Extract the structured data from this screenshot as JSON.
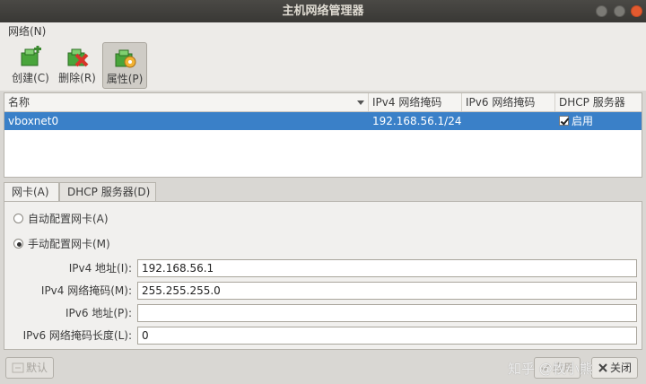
{
  "window": {
    "title": "主机网络管理器"
  },
  "menu": {
    "network": "网络(N)"
  },
  "toolbar": {
    "create": "创建(C)",
    "remove": "删除(R)",
    "properties": "属性(P)"
  },
  "table": {
    "headers": [
      "名称",
      "IPv4 网络掩码",
      "IPv6 网络掩码",
      "DHCP 服务器"
    ],
    "rows": [
      {
        "name": "vboxnet0",
        "ipv4_mask": "192.168.56.1/24",
        "ipv6_mask": "",
        "dhcp": "启用",
        "dhcp_checked": true
      }
    ]
  },
  "tabs": {
    "adapter": "网卡(A)",
    "dhcp": "DHCP 服务器(D)"
  },
  "adapter": {
    "auto_config": "自动配置网卡(A)",
    "manual_config": "手动配置网卡(M)",
    "selected": "manual",
    "ipv4_addr_label": "IPv4 地址(I):",
    "ipv4_addr_value": "192.168.56.1",
    "ipv4_mask_label": "IPv4 网络掩码(M):",
    "ipv4_mask_value": "255.255.255.0",
    "ipv6_addr_label": "IPv6 地址(P):",
    "ipv6_addr_value": "",
    "ipv6_prefix_label": "IPv6 网络掩码长度(L):",
    "ipv6_prefix_value": "0"
  },
  "buttons": {
    "default": "默认",
    "apply": "应用",
    "close": "关闭"
  },
  "watermark": "知乎 @牧小熊",
  "colors": {
    "selection": "#3a80c8",
    "titlebar": "#3c3b37",
    "close_button": "#e35a2f"
  }
}
